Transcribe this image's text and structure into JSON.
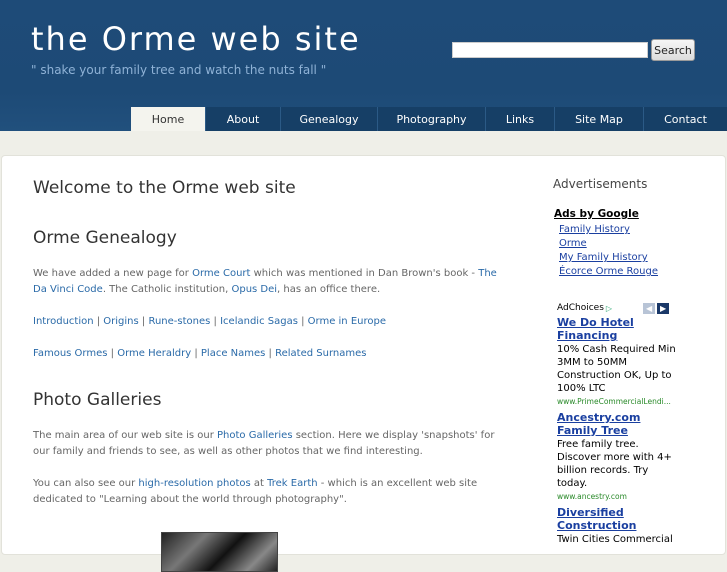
{
  "header": {
    "title": "the Orme web site",
    "tagline": "\" shake your family tree and watch the nuts fall \"",
    "search_placeholder": "",
    "search_button": "Search"
  },
  "nav": [
    {
      "label": "Home",
      "active": true
    },
    {
      "label": "About"
    },
    {
      "label": "Genealogy"
    },
    {
      "label": "Photography"
    },
    {
      "label": "Links"
    },
    {
      "label": "Site Map"
    },
    {
      "label": "Contact"
    }
  ],
  "main": {
    "page_title": "Welcome to the Orme web site",
    "genealogy": {
      "heading": "Orme Genealogy",
      "p1_a": "We have added a new page for ",
      "p1_link1": "Orme Court",
      "p1_b": " which was mentioned in Dan Brown's book - ",
      "p1_link2": "The Da Vinci Code",
      "p1_c": ". The Catholic institution, ",
      "p1_link3": "Opus Dei",
      "p1_d": ", has an office there.",
      "links_row1": [
        "Introduction",
        "Origins",
        "Rune-stones",
        "Icelandic Sagas",
        "Orme in Europe"
      ],
      "links_row2": [
        "Famous Ormes",
        "Orme Heraldry",
        "Place Names",
        "Related Surnames"
      ],
      "separator": " | "
    },
    "photos": {
      "heading": "Photo Galleries",
      "p1_a": "The main area of our web site is our ",
      "p1_link": "Photo Galleries",
      "p1_b": " section. Here we display 'snapshots' for our family and friends to see, as well as other photos that we find interesting.",
      "p2_a": "You can also see our ",
      "p2_link1": "high-resolution photos",
      "p2_b": " at ",
      "p2_link2": "Trek Earth",
      "p2_c": " - which is an excellent web site dedicated to \"Learning about the world through photography\"."
    }
  },
  "sidebar": {
    "heading": "Advertisements",
    "ads_by_google": "Ads by Google",
    "ad_links": [
      "Family History",
      "Orme",
      "My Family History",
      "Écorce Orme Rouge"
    ],
    "adchoices": "AdChoices",
    "ads": [
      {
        "title": "We Do Hotel Financing",
        "body": "10% Cash Required Min 3MM to 50MM Construction OK, Up to 100% LTC",
        "url": "www.PrimeCommercialLendi..."
      },
      {
        "title": "Ancestry.com Family Tree",
        "body": "Free family tree. Discover more with 4+ billion records. Try today.",
        "url": "www.ancestry.com"
      },
      {
        "title": "Diversified Construction",
        "body": "Twin Cities Commercial",
        "url": ""
      }
    ]
  },
  "colors": {
    "header_bg": "#1e4b78",
    "nav_bg": "#163f66",
    "link": "#2a6aa8"
  }
}
